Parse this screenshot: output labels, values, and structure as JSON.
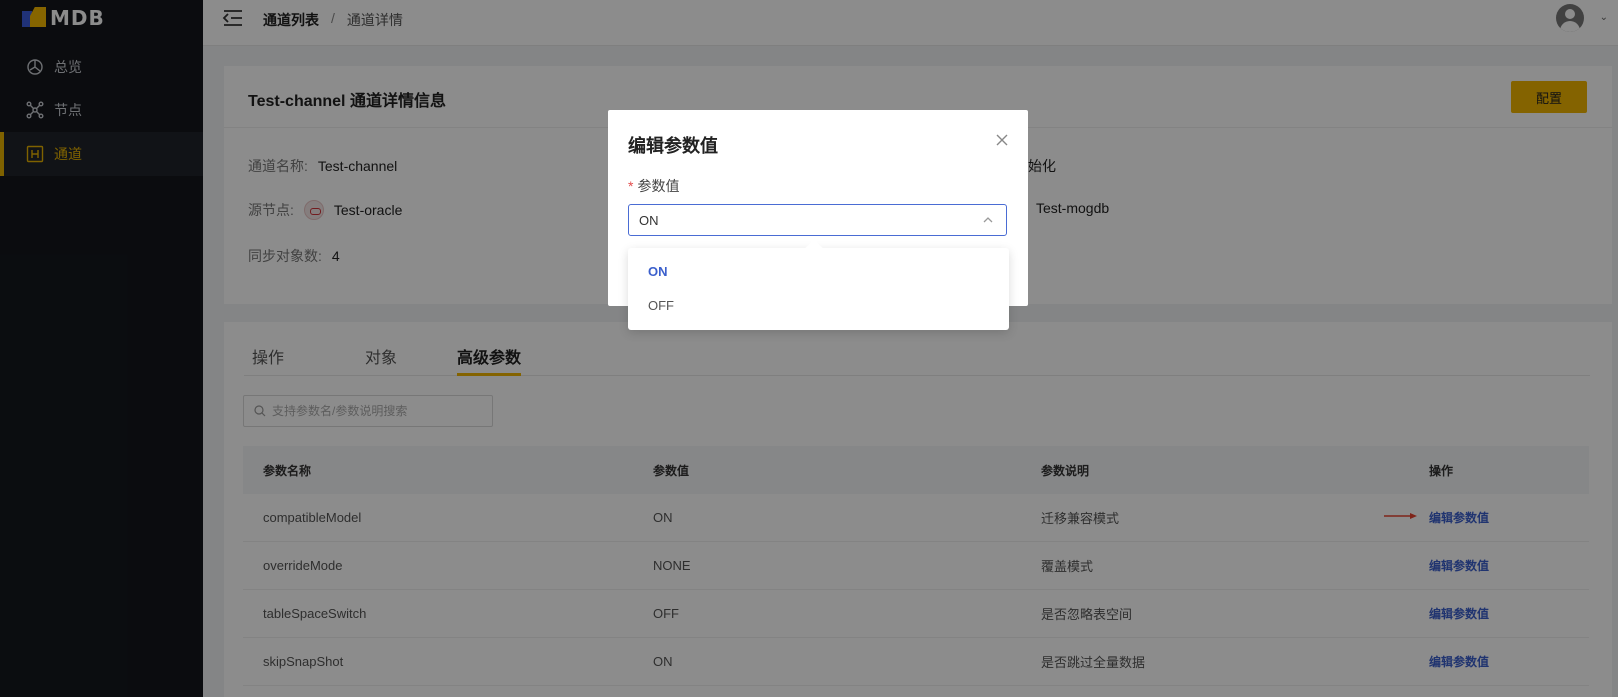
{
  "brand": {
    "logo_text": "MDB"
  },
  "sidebar": {
    "items": [
      {
        "label": "总览",
        "icon": "dashboard-icon"
      },
      {
        "label": "节点",
        "icon": "nodes-icon"
      },
      {
        "label": "通道",
        "icon": "channel-icon",
        "active": true
      }
    ]
  },
  "header": {
    "breadcrumb": {
      "first": "通道列表",
      "separator": "/",
      "current": "通道详情"
    }
  },
  "detail": {
    "title": "Test-channel 通道详情信息",
    "config_button": "配置",
    "fields": {
      "channel_name_label": "通道名称:",
      "channel_name_value": "Test-channel",
      "source_label": "源节点:",
      "source_value": "Test-oracle",
      "sync_count_label": "同步对象数:",
      "sync_count_value": "4",
      "init_fragment": "始化",
      "target_value": "Test-mogdb"
    }
  },
  "tabs": [
    {
      "label": "操作"
    },
    {
      "label": "对象"
    },
    {
      "label": "高级参数",
      "active": true
    }
  ],
  "search": {
    "placeholder": "支持参数名/参数说明搜索"
  },
  "table": {
    "headers": [
      "参数名称",
      "参数值",
      "参数说明",
      "操作"
    ],
    "rows": [
      {
        "name": "compatibleModel",
        "value": "ON",
        "desc": "迁移兼容模式",
        "action": "编辑参数值"
      },
      {
        "name": "overrideMode",
        "value": "NONE",
        "desc": "覆盖模式",
        "action": "编辑参数值"
      },
      {
        "name": "tableSpaceSwitch",
        "value": "OFF",
        "desc": "是否忽略表空间",
        "action": "编辑参数值"
      },
      {
        "name": "skipSnapShot",
        "value": "ON",
        "desc": "是否跳过全量数据",
        "action": "编辑参数值"
      }
    ]
  },
  "modal": {
    "title": "编辑参数值",
    "field_required_mark": "*",
    "field_label": "参数值",
    "selected_value": "ON",
    "options": [
      {
        "label": "ON",
        "selected": true
      },
      {
        "label": "OFF"
      }
    ]
  },
  "colors": {
    "accent": "#f0b400",
    "link": "#3b5fcc",
    "sidebar_bg": "#14171d",
    "arrow": "#e8422f"
  }
}
